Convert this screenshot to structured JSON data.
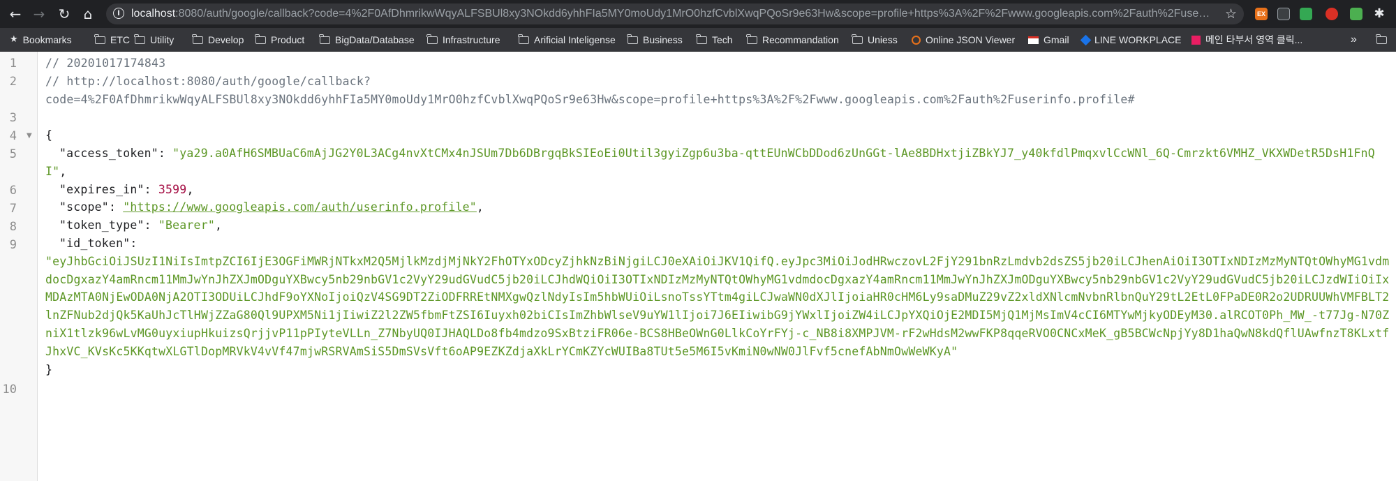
{
  "browser": {
    "url_host": "localhost",
    "url_rest": ":8080/auth/google/callback?code=4%2F0AfDhmrikwWqyALFSBUl8xy3NOkdd6yhhFIa5MY0moUdy1MrO0hzfCvblXwqPQoSr9e63Hw&scope=profile+https%3A%2F%2Fwww.googleapis.com%2Fauth%2Fuseri...",
    "accent": "#202124",
    "extensions": [
      "EX",
      "ext-2",
      "ext-3",
      "ext-4",
      "ext-5",
      "ext-6"
    ]
  },
  "bookmarks": [
    {
      "label": "Bookmarks",
      "icon": "star-icon"
    },
    {
      "label": "ETC",
      "icon": "folder-icon"
    },
    {
      "label": "Utility",
      "icon": "folder-icon"
    },
    {
      "label": "Develop",
      "icon": "folder-icon"
    },
    {
      "label": "Product",
      "icon": "folder-icon"
    },
    {
      "label": "BigData/Database",
      "icon": "folder-icon"
    },
    {
      "label": "Infrastructure",
      "icon": "folder-icon"
    },
    {
      "label": "Arificial Inteligense",
      "icon": "folder-icon"
    },
    {
      "label": "Business",
      "icon": "folder-icon"
    },
    {
      "label": "Tech",
      "icon": "folder-icon"
    },
    {
      "label": "Recommandation",
      "icon": "folder-icon"
    },
    {
      "label": "Uniess",
      "icon": "folder-icon"
    },
    {
      "label": "Online JSON Viewer",
      "icon": "json-viewer-icon"
    },
    {
      "label": "Gmail",
      "icon": "gmail-icon"
    },
    {
      "label": "LINE WORKPLACE",
      "icon": "line-icon"
    },
    {
      "label": "메인 타부서 영역 클릭...",
      "icon": "bookmark-favicon-icon"
    }
  ],
  "overflow_label": "»",
  "json_view": {
    "line_numbers": [
      "1",
      "2",
      "3",
      "4",
      "5",
      "6",
      "7",
      "8",
      "9",
      "10"
    ],
    "comment_timestamp": "// 20201017174843",
    "comment_url_line1": "// http://localhost:8080/auth/google/callback?",
    "comment_url_line2": "code=4%2F0AfDhmrikwWqyALFSBUl8xy3NOkdd6yhhFIa5MY0moUdy1MrO0hzfCvblXwqPQoSr9e63Hw&scope=profile+https%3A%2F%2Fwww.googleapis.com%2Fauth%2Fuserinfo.profile#",
    "open_brace": "{",
    "close_brace": "}",
    "access_token_key": "\"access_token\"",
    "access_token_value": "\"ya29.a0AfH6SMBUaC6mAjJG2Y0L3ACg4nvXtCMx4nJSUm7Db6DBrgqBkSIEoEi0Util3gyiZgp6u3ba-qttEUnWCbDDod6zUnGGt-lAe8BDHxtjiZBkYJ7_y40kfdlPmqxvlCcWNl_6Q-Cmrzkt6VMHZ_VKXWDetR5DsH1FnQI\"",
    "expires_in_key": "\"expires_in\"",
    "expires_in_value": "3599",
    "scope_key": "\"scope\"",
    "scope_value": "\"https://www.googleapis.com/auth/userinfo.profile\"",
    "token_type_key": "\"token_type\"",
    "token_type_value": "\"Bearer\"",
    "id_token_key": "\"id_token\"",
    "id_token_value": "\"eyJhbGciOiJSUzI1NiIsImtpZCI6IjE3OGFiMWRjNTkxM2Q5MjlkMzdjMjNkY2FhOTYxODcyZjhkNzBiNjgiLCJ0eXAiOiJKV1QifQ.eyJpc3MiOiJodHRwczovL2FjY291bnRzLmdvb2dsZS5jb20iLCJhenAiOiI3OTIxNDIzMzMyNTQtOWhyMG1vdmdocDgxazY4amRncm11MmJwYnJhZXJmODguYXBwcy5nb29nbGV1c2VyY29udGVudC5jb20iLCJhdWQiOiI3OTIxNDIzMzMyNTQtOWhyMG1vdmdocDgxazY4amRncm11MmJwYnJhZXJmODguYXBwcy5nb29nbGV1c2VyY29udGVudC5jb20iLCJzdWIiOiIxMDAzMTA0NjEwODA0NjA2OTI3ODUiLCJhdF9oYXNoIjoiQzV4SG9DT2ZiODFRREtNMXgwQzlNdyIsIm5hbWUiOiLsnoTssYTtm4giLCJwaWN0dXJlIjoiaHR0cHM6Ly9saDMuZ29vZ2xldXNlcmNvbnRlbnQuY29tL2EtL0FPaDE0R2o2UDRUUWhVMFBLT2lnZFNub2djQk5KaUhJcTlHWjZZaG80Ql9UPXM5Ni1jIiwiZ2l2ZW5fbmFtZSI6Iuyxh02biCIsImZhbWlseV9uYW1lIjoi7J6EIiwibG9jYWxlIjoiZW4iLCJpYXQiOjE2MDI5MjQ1MjMsImV4cCI6MTYwMjkyODEyM30.alRCOT0Ph_MW_-t77Jg-N70ZniX1tlzk96wLvMG0uyxiupHkuizsQrjjvP11pPIyteVLLn_Z7NbyUQ0IJHAQLDo8fb4mdzo9SxBtziFR06e-BCS8HBeOWnG0LlkCoYrFYj-c_NB8i8XMPJVM-rF2wHdsM2wwFKP8qqeRVO0CNCxMeK_gB5BCWcNpjYy8D1haQwN8kdQflUAwfnzT8KLxtfJhxVC_KVsKc5KKqtwXLGTlDopMRVkV4vVf47mjwRSRVAmSiS5DmSVsVft6oAP9EZKZdjaXkLrYCmKZYcWUIBa8TUt5e5M6I5vKmiN0wNW0JlFvf5cnefAbNmOwWeWKyA\""
  }
}
